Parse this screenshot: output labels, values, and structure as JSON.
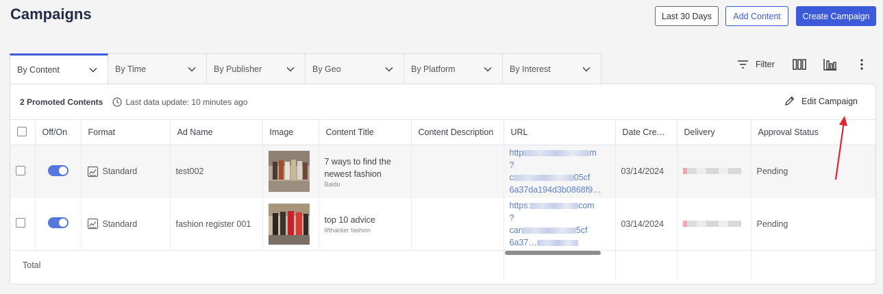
{
  "page": {
    "title": "Campaigns"
  },
  "toolbar": {
    "date_range_label": "Last 30 Days",
    "add_content_label": "Add Content",
    "create_campaign_label": "Create Campaign",
    "filter_label": "Filter"
  },
  "tabs": [
    {
      "label": "By Content",
      "active": true
    },
    {
      "label": "By Time"
    },
    {
      "label": "By Publisher"
    },
    {
      "label": "By Geo"
    },
    {
      "label": "By Platform"
    },
    {
      "label": "By Interest"
    }
  ],
  "summary": {
    "promoted": "2 Promoted Contents",
    "last_update": "Last data update: 10 minutes ago",
    "edit_campaign_label": "Edit Campaign"
  },
  "table": {
    "columns": [
      "Off/On",
      "Format",
      "Ad Name",
      "Image",
      "Content Title",
      "Content Description",
      "URL",
      "Date Creat…",
      "Delivery",
      "Approval Status"
    ],
    "rows": [
      {
        "on": true,
        "format": "Standard",
        "ad_name": "test002",
        "content_title": "7 ways to find the newest fashion",
        "content_source": "Baidu",
        "content_description": "",
        "url_line1": "http",
        "url_line1_end": "m",
        "url_line2": "?",
        "url_line3": "c",
        "url_line3_end": "05cf",
        "url_line4": "6a37da194d3b0868f9…",
        "date_created": "03/14/2024",
        "approval_status": "Pending"
      },
      {
        "on": true,
        "format": "Standard",
        "ad_name": "fashion register 001",
        "content_title": "top 10 advice",
        "content_source": "lifthacker fashion",
        "content_description": "",
        "url_line1": "https:",
        "url_line1_end": "com",
        "url_line2": "?",
        "url_line3": "car",
        "url_line3_end": "5cf",
        "url_line4": "6a37…",
        "date_created": "03/14/2024",
        "approval_status": "Pending"
      }
    ],
    "total_label": "Total"
  },
  "icons": {
    "filter": "filter-lines-icon",
    "columns": "columns-icon",
    "chart": "bar-chart-icon",
    "more": "vertical-dots-icon",
    "edit": "pencil-icon",
    "clock": "clock-icon",
    "format": "image-chart-icon"
  },
  "colors": {
    "accent": "#3b5bdb",
    "link": "#5a7fcf",
    "annotation_arrow": "#e02434"
  }
}
